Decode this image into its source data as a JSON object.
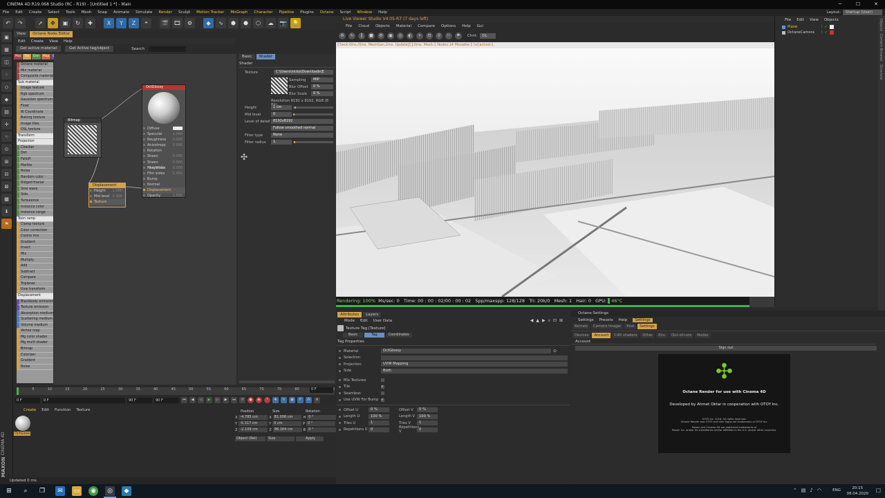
{
  "window": {
    "title": "CINEMA 4D R19.068 Studio (RC - R19) - [Untitled 1 *] - Main",
    "min": "─",
    "max": "☐",
    "close": "✕"
  },
  "menu": [
    {
      "label": "File"
    },
    {
      "label": "Edit"
    },
    {
      "label": "Create"
    },
    {
      "label": "Select"
    },
    {
      "label": "Tools"
    },
    {
      "label": "Mesh"
    },
    {
      "label": "Snap"
    },
    {
      "label": "Animate"
    },
    {
      "label": "Simulate"
    },
    {
      "label": "Render"
    },
    {
      "label": "Sculpt"
    },
    {
      "label": "Motion Tracker"
    },
    {
      "label": "MoGraph"
    },
    {
      "label": "Character"
    },
    {
      "label": "Pipeline"
    },
    {
      "label": "Plugins"
    },
    {
      "label": "Octane"
    },
    {
      "label": "Script"
    },
    {
      "label": "Window"
    },
    {
      "label": "Help"
    }
  ],
  "layout": {
    "label": "Layout:",
    "value": "Startup (User)"
  },
  "toolbar": {
    "x": "X",
    "y": "Y",
    "z": "Z"
  },
  "nodeEditor": {
    "tabs": [
      "View",
      "Octane Node Editor"
    ],
    "menu": [
      "Edit",
      "Create",
      "View",
      "Help"
    ],
    "get_active_material": "Get active material",
    "get_active_tag": "Get Active tag/object",
    "search_label": "Search",
    "categories": [
      {
        "label": "Mat",
        "color": "#a04444"
      },
      {
        "label": "Tex",
        "color": "#d4a24a"
      },
      {
        "label": "Gen",
        "color": "#5a8a46"
      },
      {
        "label": "Map",
        "color": "#c86a3a"
      },
      {
        "label": "Oth",
        "color": "#6c4ea4"
      },
      {
        "label": "Ems",
        "color": "#4a7cbc"
      },
      {
        "label": "Med",
        "color": "#3a8a8a"
      },
      {
        "label": "C4D",
        "color": "#555555"
      }
    ],
    "nodes": [
      {
        "label": "Octane material",
        "cls": "c0"
      },
      {
        "label": "Mix material",
        "cls": "c0"
      },
      {
        "label": "Composite material",
        "cls": "c0"
      },
      {
        "label": "Sub material",
        "cls": "hd"
      },
      {
        "label": "Image texture",
        "cls": "c1"
      },
      {
        "label": "Rgb spectrum",
        "cls": "c1"
      },
      {
        "label": "Gaussian spectrum",
        "cls": "c1"
      },
      {
        "label": "Float",
        "cls": "c1"
      },
      {
        "label": "W Coordinate",
        "cls": "c1"
      },
      {
        "label": "Baking texture",
        "cls": "c1"
      },
      {
        "label": "Image tiles",
        "cls": "c1"
      },
      {
        "label": "OSL texture",
        "cls": "c1"
      },
      {
        "label": "Transform",
        "cls": "hd"
      },
      {
        "label": "Projection",
        "cls": "hd"
      },
      {
        "label": "Checker",
        "cls": "c2"
      },
      {
        "label": "Dirt",
        "cls": "c2"
      },
      {
        "label": "Falloff",
        "cls": "c2"
      },
      {
        "label": "Marble",
        "cls": "c2"
      },
      {
        "label": "Noise",
        "cls": "c2"
      },
      {
        "label": "Random color",
        "cls": "c2"
      },
      {
        "label": "Ridged fractal",
        "cls": "c2"
      },
      {
        "label": "Sine wave",
        "cls": "c2"
      },
      {
        "label": "Side",
        "cls": "c2"
      },
      {
        "label": "Turbulence",
        "cls": "c2"
      },
      {
        "label": "Instance color",
        "cls": "c2"
      },
      {
        "label": "Instance range",
        "cls": "c2"
      },
      {
        "label": "Toon ramp",
        "cls": "hd"
      },
      {
        "label": "Clamp texture",
        "cls": "c1"
      },
      {
        "label": "Color correction",
        "cls": "c1"
      },
      {
        "label": "Cosine mix",
        "cls": "c1"
      },
      {
        "label": "Gradient",
        "cls": "c1"
      },
      {
        "label": "Invert",
        "cls": "c1"
      },
      {
        "label": "Mix",
        "cls": "c1"
      },
      {
        "label": "Multiply",
        "cls": "c1"
      },
      {
        "label": "Add",
        "cls": "c1"
      },
      {
        "label": "Subtract",
        "cls": "c1"
      },
      {
        "label": "Compare",
        "cls": "c1"
      },
      {
        "label": "Triplanar",
        "cls": "c1"
      },
      {
        "label": "Uvw transform",
        "cls": "c1"
      },
      {
        "label": "Displacement",
        "cls": "hd"
      },
      {
        "label": "Blackbody emission",
        "cls": "c3"
      },
      {
        "label": "Texture emission",
        "cls": "c3"
      },
      {
        "label": "Absorption medium",
        "cls": "c4"
      },
      {
        "label": "Scattering medium",
        "cls": "c4"
      },
      {
        "label": "Volume medium",
        "cls": "c4"
      },
      {
        "label": "Vertex map",
        "cls": "c1"
      },
      {
        "label": "Mg color shader",
        "cls": "c1"
      },
      {
        "label": "Mg multi shader",
        "cls": "c1"
      },
      {
        "label": "Bitmap",
        "cls": "c1"
      },
      {
        "label": "Colorizer",
        "cls": "c1"
      },
      {
        "label": "Gradient",
        "cls": "c1"
      },
      {
        "label": "Noise",
        "cls": "c1"
      }
    ],
    "graph": {
      "bitmap": {
        "title": "Bitmap"
      },
      "displacement": {
        "title": "Displacement",
        "params": [
          {
            "k": "Height",
            "v": "1.000"
          },
          {
            "k": "Mid level",
            "v": "0.000"
          },
          {
            "k": "Texture",
            "v": ""
          }
        ]
      },
      "octglossy": {
        "title": "OctGlossy",
        "params": [
          {
            "k": "Diffuse",
            "v": ""
          },
          {
            "k": "Specular",
            "v": "1.000"
          },
          {
            "k": "Roughness",
            "v": "0.000"
          },
          {
            "k": "Anisotropy",
            "v": "0.000"
          },
          {
            "k": "Rotation",
            "v": ""
          },
          {
            "k": "Sheen",
            "v": "0.000"
          },
          {
            "k": "Sheen roughness",
            "v": "0.000"
          },
          {
            "k": "Film Width",
            "v": "0.000"
          },
          {
            "k": "Film index",
            "v": "1.450"
          },
          {
            "k": "Bump",
            "v": ""
          },
          {
            "k": "Normal",
            "v": ""
          },
          {
            "k": "Displacement",
            "v": ""
          },
          {
            "k": "Opacity",
            "v": "1.000"
          }
        ]
      }
    }
  },
  "shaderPanel": {
    "tabs": [
      "Basic",
      "Shader"
    ],
    "title": "Shader",
    "texture_label": "Texture",
    "texture_path": "C:\\Users\\nicko\\Downloads\\E",
    "sampling_label": "Sampling",
    "sampling_value": "MIP",
    "blur_offset_label": "Blur Offset",
    "blur_offset_value": "0 %",
    "blur_scale_label": "Blur Scale",
    "blur_scale_value": "0 %",
    "resolution": "Resolution 8192 x 8192, RGB (8 Bit),",
    "height_label": "Height",
    "height_value": "1 cm",
    "mid_level_label": "Mid level",
    "mid_level_value": "0",
    "lod_label": "Level of detail",
    "lod_value": "8192x8192",
    "follow_smoothed": "Follow smoothed normal",
    "filter_type_label": "Filter type",
    "filter_type_value": "None",
    "filter_radius_label": "Filter radius",
    "filter_radius_value": "1."
  },
  "liveViewer": {
    "title": "Live Viewer Studio V4.05-R7 (7 days left)",
    "menu": [
      "File",
      "Cloud",
      "Objects",
      "Material",
      "Compare",
      "Options",
      "Help",
      "Gui"
    ],
    "channel_label": "Chnl:",
    "channel_value": "DL",
    "status": "Check:0ms./0ms. MeshGen:2ms. Update[C]:0ms. Mesh:1 Nodes:14 Movable:1 txCached:1",
    "stats": {
      "rendering": "Rendering: 100%",
      "ms": "Ms/sec: 0",
      "time": "Time: 00 : 00 : 02/00 : 00 : 02",
      "spp": "Spp/maxspp: 128/128",
      "tri": "Tri: 20k/0",
      "mesh": "Mesh: 1",
      "hair": "Hair: 0",
      "gpu": "GPU:",
      "temp": "46°C"
    }
  },
  "objectManager": {
    "menu": [
      "File",
      "Edit",
      "View",
      "Objects"
    ],
    "objects": [
      {
        "name": "Plane",
        "color": "#f0c64a"
      },
      {
        "name": "OctaneCamera",
        "color": "#cccccc"
      }
    ],
    "side_tabs": [
      "Objects",
      "Content Browser",
      "Structure"
    ]
  },
  "timeline": {
    "ticks": [
      "0",
      "5",
      "10",
      "15",
      "20",
      "25",
      "30",
      "35",
      "40",
      "45",
      "50",
      "55",
      "60",
      "65",
      "70",
      "75",
      "80",
      "85",
      "90"
    ],
    "start": "0 F",
    "mid": "0 F",
    "min": "90 F",
    "end": "90 F",
    "current": "0 F"
  },
  "materialPanel": {
    "menu": [
      "Create",
      "Edit",
      "Function",
      "Texture"
    ],
    "material_name": "OctGloss"
  },
  "coords": {
    "headers": [
      "Position",
      "Size",
      "Rotation"
    ],
    "rows": [
      {
        "axis": "X",
        "pos": "-4.785 cm",
        "ax2": "X",
        "size": "81.006 cm",
        "ax3": "H",
        "rot": "0 °"
      },
      {
        "axis": "Y",
        "pos": "-5.317 cm",
        "ax2": "Y",
        "size": "0 cm",
        "ax3": "P",
        "rot": "0 °"
      },
      {
        "axis": "Z",
        "pos": "-2.109 cm",
        "ax2": "Z",
        "size": "96.164 cm",
        "ax3": "B",
        "rot": "0 °"
      }
    ],
    "mode": "Object (Rel)",
    "size_mode": "Size",
    "apply": "Apply"
  },
  "statusbar": "Updated 0 ms.",
  "attributes": {
    "tabs": [
      "Attributes",
      "Layers"
    ],
    "menu": [
      "Mode",
      "Edit",
      "User Data"
    ],
    "title": "Texture Tag [Texture]",
    "subtabs": [
      "Basic",
      "Tag",
      "Coordinates"
    ],
    "section": "Tag Properties",
    "material_label": "Material",
    "material_value": "OctGlossy",
    "selection_label": "Selection",
    "projection_label": "Projection",
    "projection_value": "UVW Mapping",
    "side_label": "Side",
    "side_value": "Both",
    "mix_label": "Mix Textures",
    "tile_label": "Tile",
    "seamless_label": "Seamless",
    "uvw_bump_label": "Use UVW For Bump",
    "check": "✓",
    "offset_u_label": "Offset U",
    "offset_u": "0 %",
    "offset_v_label": "Offset V",
    "offset_v": "0 %",
    "length_u_label": "Length U",
    "length_u": "100 %",
    "length_v_label": "Length V",
    "length_v": "100 %",
    "tiles_u_label": "Tiles U",
    "tiles_u": "1",
    "tiles_v_label": "Tiles V",
    "tiles_v": "1",
    "rep_u_label": "Repetitions U",
    "rep_u": "0",
    "rep_v_label": "Repetitions V",
    "rep_v": "0"
  },
  "octaneSettings": {
    "title": "Octane Settings",
    "menu": [
      "Settings",
      "Presets",
      "Help"
    ],
    "settings_tab": "Settings",
    "tabs": [
      "Kernels",
      "Camera Imager",
      "Post",
      "Settings"
    ],
    "subtabs": [
      "Devices",
      "Account",
      "C4D shaders",
      "Other",
      "Env.",
      "Out-of-core",
      "Nodes"
    ],
    "account_label": "Account",
    "sign_out": "Sign out",
    "splash_title": "Octane Render for use with Cinema 4D",
    "splash_dev": "Developed by Ahmet Oktar in cooperation with OTOY Inc.",
    "splash_copy1": "OTOY Inc. 2016. All rights reserved.",
    "splash_copy2": "Octane Render and OTOY and their logos are trademarks of OTOY Inc.",
    "splash_copy3": "Maxon and Cinema 4D are registered trademarks of",
    "splash_copy4": "Maxon Inc. and/or its subsidiaries and/or affiliates in the U.S. and/or other countries."
  },
  "taskbar": {
    "time": "20:15",
    "date": "08.04.2020",
    "lang": "ENG"
  },
  "brand": {
    "maxon": "MAXON",
    "c4d": "CINEMA 4D"
  }
}
